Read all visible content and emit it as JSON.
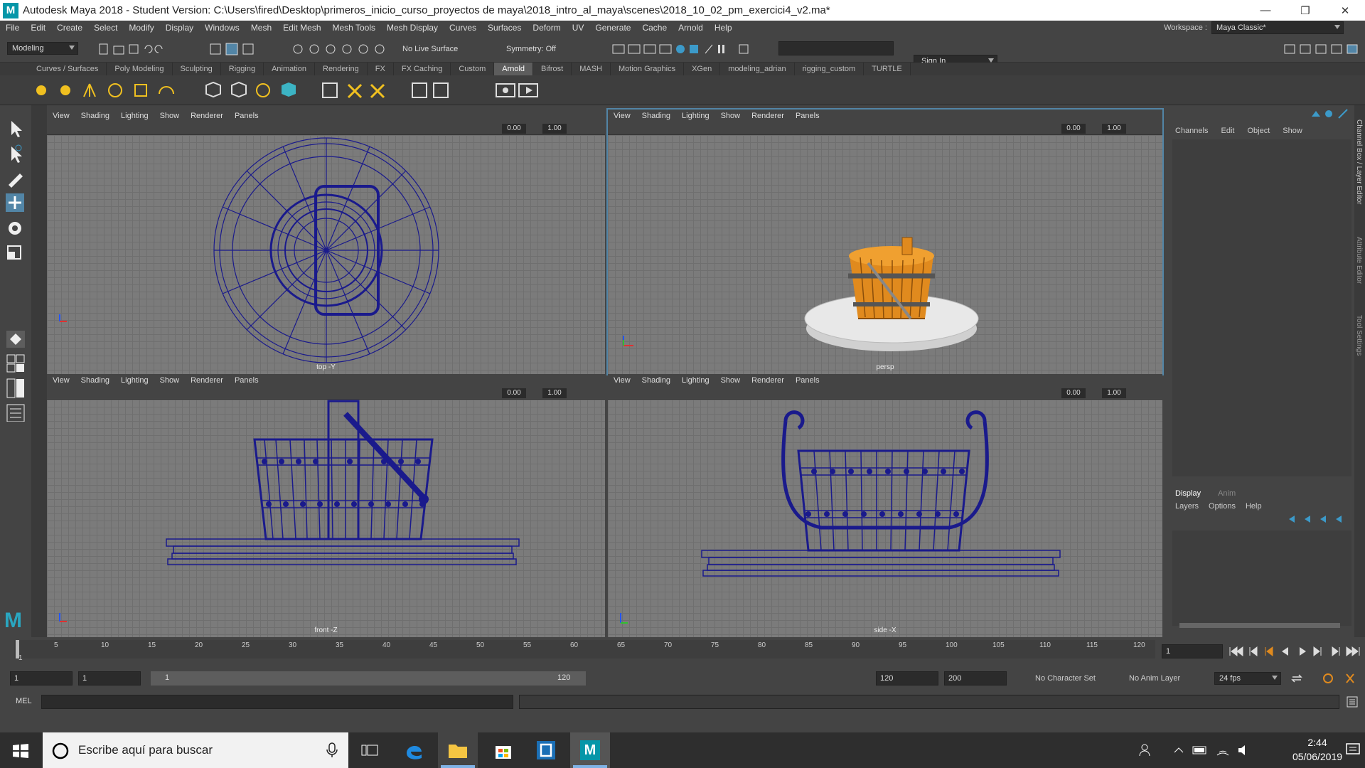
{
  "window": {
    "title": "Autodesk Maya 2018 - Student Version: C:\\Users\\fired\\Desktop\\primeros_inicio_curso_proyectos de maya\\2018_intro_al_maya\\scenes\\2018_10_02_pm_exercici4_v2.ma*",
    "logo": "M",
    "min": "—",
    "max": "❐",
    "close": "✕"
  },
  "menu": [
    "File",
    "Edit",
    "Create",
    "Select",
    "Modify",
    "Display",
    "Windows",
    "Mesh",
    "Edit Mesh",
    "Mesh Tools",
    "Mesh Display",
    "Curves",
    "Surfaces",
    "Deform",
    "UV",
    "Generate",
    "Cache",
    "Arnold",
    "Help"
  ],
  "workspace": {
    "label": "Workspace :",
    "value": "Maya Classic*"
  },
  "status": {
    "mode": "Modeling",
    "live_surface": "No Live Surface",
    "symmetry": "Symmetry: Off",
    "signin": "Sign In"
  },
  "shelf_tabs": [
    "Curves / Surfaces",
    "Poly Modeling",
    "Sculpting",
    "Rigging",
    "Animation",
    "Rendering",
    "FX",
    "FX Caching",
    "Custom",
    "Arnold",
    "Bifrost",
    "MASH",
    "Motion Graphics",
    "XGen",
    "modeling_adrian",
    "rigging_custom",
    "TURTLE"
  ],
  "shelf_active": "Arnold",
  "viewport_menu": [
    "View",
    "Shading",
    "Lighting",
    "Show",
    "Renderer",
    "Panels"
  ],
  "viewport_fields": {
    "a": "0.00",
    "b": "1.00"
  },
  "viewports": {
    "top": "top -Y",
    "persp": "persp",
    "front": "front -Z",
    "side": "side -X"
  },
  "channel_box": {
    "tabs": [
      "Channels",
      "Edit",
      "Object",
      "Show"
    ],
    "side_labels": [
      "Channel Box / Layer Editor",
      "Attribute Editor",
      "Tool Settings"
    ]
  },
  "layer_editor": {
    "tabs": [
      "Display",
      "Anim"
    ],
    "menu": [
      "Layers",
      "Options",
      "Help"
    ]
  },
  "timeline": {
    "ticks": [
      "1",
      "5",
      "10",
      "15",
      "20",
      "25",
      "30",
      "35",
      "40",
      "45",
      "50",
      "55",
      "60",
      "65",
      "70",
      "75",
      "80",
      "85",
      "90",
      "95",
      "100",
      "105",
      "110",
      "115",
      "120"
    ],
    "current": "1"
  },
  "range": {
    "start": "1",
    "start2": "1",
    "slider_start": "1",
    "slider_end": "120",
    "end": "120",
    "end2": "200",
    "character": "No Character Set",
    "anim_layer": "No Anim Layer",
    "fps": "24 fps"
  },
  "mel": {
    "label": "MEL"
  },
  "taskbar": {
    "search": "Escribe aquí para buscar",
    "time": "2:44",
    "date": "05/06/2019"
  },
  "colors": {
    "wire": "#1a1a8c",
    "bucket": "#e08a1e",
    "accent": "#5285a6"
  }
}
